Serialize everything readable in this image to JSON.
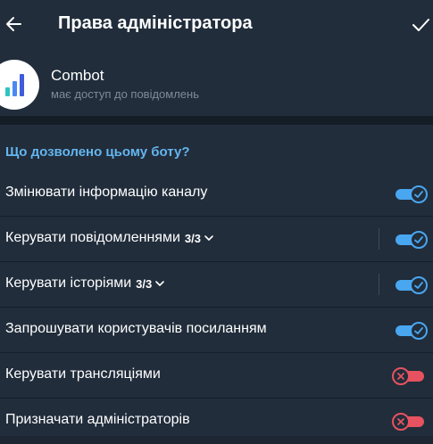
{
  "header": {
    "title": "Права адміністратора",
    "back_icon": "arrow-left-icon",
    "confirm_icon": "checkmark-icon"
  },
  "bot": {
    "name": "Combot",
    "status": "має доступ до повідомлень",
    "avatar_icon": "bar-chart-logo"
  },
  "permissions": {
    "title": "Що дозволено цьому боту?",
    "items": [
      {
        "label": "Змінювати інформацію каналу",
        "count": "",
        "expandable": false,
        "enabled": true
      },
      {
        "label": "Керувати повідомленнями",
        "count": "3/3",
        "expandable": true,
        "enabled": true
      },
      {
        "label": "Керувати історіями",
        "count": "3/3",
        "expandable": true,
        "enabled": true
      },
      {
        "label": "Запрошувати користувачів посиланням",
        "count": "",
        "expandable": false,
        "enabled": true
      },
      {
        "label": "Керувати трансляціями",
        "count": "",
        "expandable": false,
        "enabled": false
      },
      {
        "label": "Призначати адміністраторів",
        "count": "",
        "expandable": false,
        "enabled": false
      }
    ]
  },
  "colors": {
    "background": "#1d2733",
    "surface": "#212d3b",
    "accent": "#64b5ef",
    "toggle_on": "#49a6f0",
    "toggle_off": "#e6525f",
    "secondary_text": "#7f8b98"
  }
}
